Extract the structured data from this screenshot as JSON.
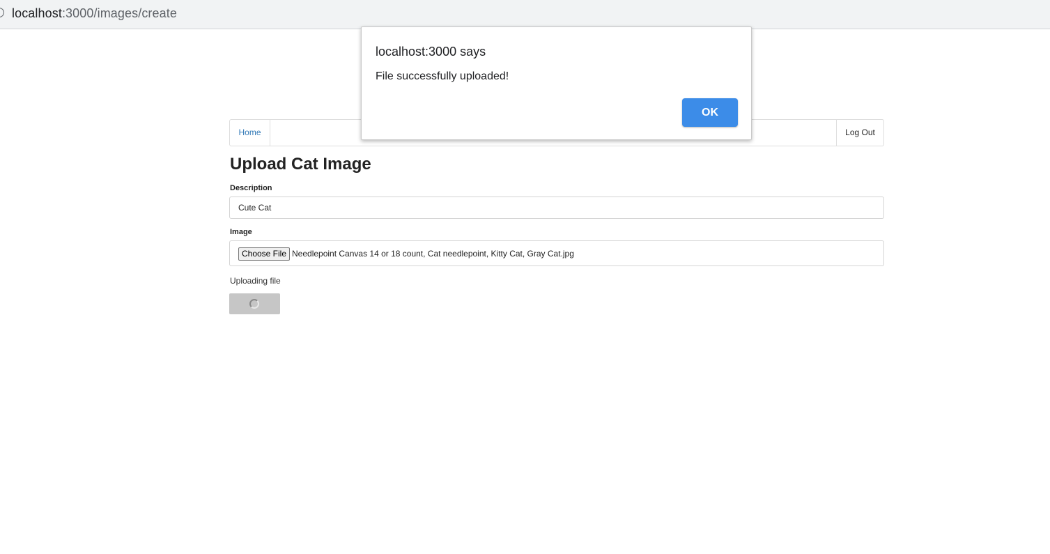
{
  "browser": {
    "url_host": "localhost",
    "url_path": ":3000/images/create"
  },
  "navbar": {
    "home_label": "Home",
    "logout_label": "Log Out"
  },
  "page": {
    "title": "Upload Cat Image",
    "description_label": "Description",
    "description_value": "Cute Cat",
    "image_label": "Image",
    "choose_file_label": "Choose File",
    "file_name": "Needlepoint Canvas 14 or 18 count, Cat needlepoint, Kitty Cat, Gray Cat.jpg",
    "uploading_text": "Uploading file"
  },
  "dialog": {
    "title": "localhost:3000 says",
    "message": "File successfully uploaded!",
    "ok_label": "OK"
  },
  "colors": {
    "link": "#337ab7",
    "ok_button": "#3c8ce8",
    "disabled_button": "#c6c6c6"
  }
}
